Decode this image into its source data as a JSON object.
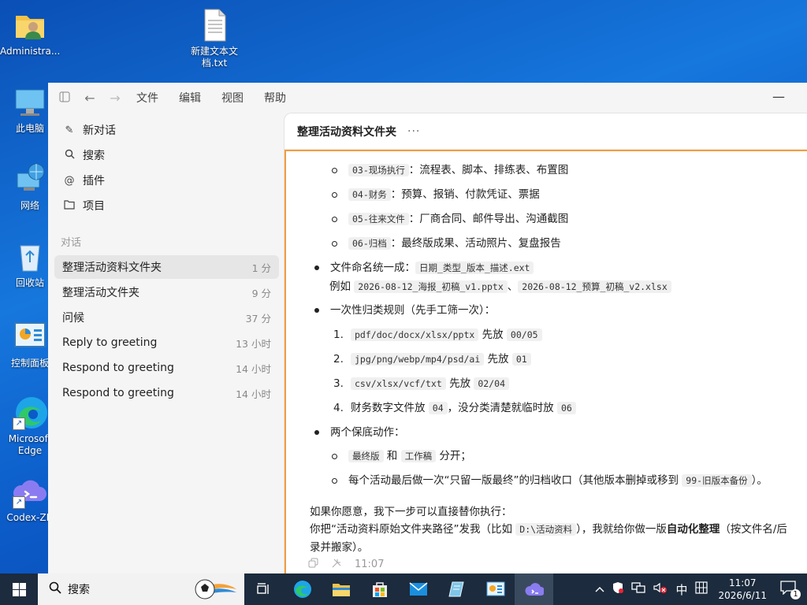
{
  "desktop": {
    "icons": [
      {
        "label": "Administra..."
      },
      {
        "label": "新建文本文档.txt"
      },
      {
        "label": "此电脑"
      },
      {
        "label": "网络"
      },
      {
        "label": "回收站"
      },
      {
        "label": "控制面板"
      },
      {
        "label": "Microsoft Edge"
      },
      {
        "label": "Codex-ZH"
      }
    ]
  },
  "window": {
    "menu": [
      "文件",
      "编辑",
      "视图",
      "帮助"
    ],
    "sidebar": {
      "actions": [
        "新对话",
        "搜索",
        "插件",
        "项目"
      ],
      "section_label": "对话",
      "conversations": [
        {
          "title": "整理活动资料文件夹",
          "time": "1 分"
        },
        {
          "title": "整理活动文件夹",
          "time": "9 分"
        },
        {
          "title": "问候",
          "time": "37 分"
        },
        {
          "title": "Reply to greeting",
          "time": "13 小时"
        },
        {
          "title": "Respond to greeting",
          "time": "14 小时"
        },
        {
          "title": "Respond to greeting",
          "time": "14 小时"
        }
      ]
    },
    "main": {
      "title": "整理活动资料文件夹",
      "content": {
        "folders": [
          {
            "code": "03-现场执行",
            "desc": "：流程表、脚本、排练表、布置图"
          },
          {
            "code": "04-财务",
            "desc": "：预算、报销、付款凭证、票据"
          },
          {
            "code": "05-往来文件",
            "desc": "：厂商合同、邮件导出、沟通截图"
          },
          {
            "code": "06-归档",
            "desc": "：最终版成果、活动照片、复盘报告"
          }
        ],
        "naming_label": "文件命名统一成：",
        "naming_code": "日期_类型_版本_描述.ext",
        "example_label": "例如",
        "example_1": "2026-08-12_海报_初稿_v1.pptx",
        "example_sep": "、",
        "example_2": "2026-08-12_预算_初稿_v2.xlsx",
        "rules_label": "一次性归类规则（先手工筛一次）：",
        "rules": [
          {
            "n": "1.",
            "code": "pdf/doc/docx/xlsx/pptx",
            "mid": "先放",
            "target": "00/05",
            "tail": ""
          },
          {
            "n": "2.",
            "code": "jpg/png/webp/mp4/psd/ai",
            "mid": "先放",
            "target": "01",
            "tail": ""
          },
          {
            "n": "3.",
            "code": "csv/xlsx/vcf/txt",
            "mid": "先放",
            "target": "02/04",
            "tail": ""
          },
          {
            "n": "4.",
            "code": "",
            "mid": "财务数字文件放",
            "target": "04",
            "tail": "，没分类清楚就临时放",
            "target2": "06"
          }
        ],
        "safeguard_label": "两个保底动作：",
        "safeguard_1": {
          "code1": "最终版",
          "mid": "和",
          "code2": "工作稿",
          "tail": "分开；"
        },
        "safeguard_2": {
          "text": "每个活动最后做一次“只留一版最终”的归档收口（其他版本删掉或移到",
          "code": "99-旧版本备份",
          "tail": "）。"
        },
        "outro_1": "如果你愿意，我下一步可以直接替你执行：",
        "outro_2a": "你把“活动资料原始文件夹路径”发我（比如",
        "outro_2code": "D:\\活动资料",
        "outro_2b": "），我就给你做一版",
        "outro_2bold": "自动化整理",
        "outro_2c": "（按文件名/后",
        "outro_3": "录并搬家）。",
        "time": "11:07"
      }
    }
  },
  "taskbar": {
    "search_label": "搜索",
    "ime": "中",
    "time": "11:07",
    "date": "2026/6/11",
    "notification_count": "1"
  }
}
